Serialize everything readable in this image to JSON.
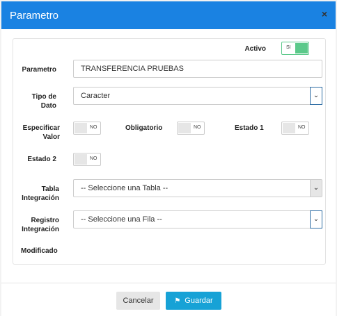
{
  "modal": {
    "title": "Parametro",
    "close": "×"
  },
  "form": {
    "activo": {
      "label": "Activo",
      "value": "SI",
      "color": "#5bc98a"
    },
    "parametro": {
      "label": "Parametro",
      "value": "TRANSFERENCIA PRUEBAS"
    },
    "tipo": {
      "label1": "Tipo de",
      "label2": "Dato",
      "value": "Caracter"
    },
    "especificar": {
      "label1": "Especificar",
      "label2": "Valor",
      "value": "NO"
    },
    "obligatorio": {
      "label": "Obligatorio",
      "value": "NO"
    },
    "estado1": {
      "label": "Estado 1",
      "value": "NO"
    },
    "estado2": {
      "label": "Estado 2",
      "value": "NO"
    },
    "tabla": {
      "label1": "Tabla",
      "label2": "Integración",
      "value": "-- Seleccione una Tabla --"
    },
    "registro": {
      "label1": "Registro",
      "label2": "Integración",
      "value": "-- Seleccione una Fila --"
    },
    "modificado": {
      "label": "Modificado"
    }
  },
  "footer": {
    "cancel": "Cancelar",
    "save": "Guardar",
    "save_color": "#17a2d6"
  }
}
